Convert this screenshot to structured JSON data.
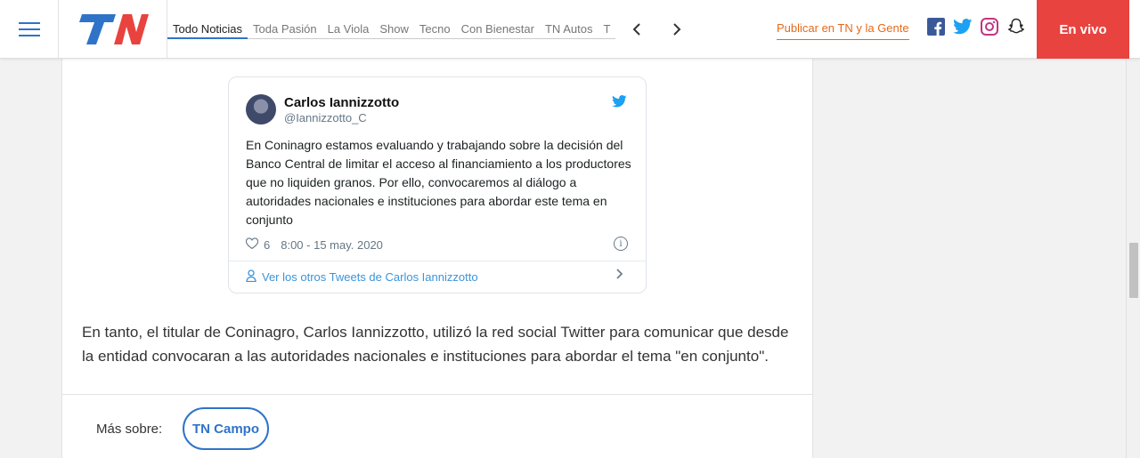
{
  "header": {
    "logo_text": "TN",
    "nav_items": [
      "Todo Noticias",
      "Toda Pasión",
      "La Viola",
      "Show",
      "Tecno",
      "Con Bienestar",
      "TN Autos",
      "T"
    ],
    "publish_link": "Publicar en TN y la Gente",
    "live_button": "En vivo",
    "social_icons": [
      "facebook-icon",
      "twitter-icon",
      "instagram-icon",
      "snapchat-icon"
    ]
  },
  "tweet": {
    "author_name": "Carlos Iannizzotto",
    "author_handle": "@Iannizzotto_C",
    "text": "En Coninagro estamos evaluando y trabajando sobre la decisión del Banco Central de limitar el acceso al financiamiento a los productores que no liquiden granos. Por ello, convocaremos al diálogo a autoridades nacionales e instituciones para abordar este tema en conjunto",
    "likes": "6",
    "timestamp": "8:00 - 15 may. 2020",
    "more_link": "Ver los otros Tweets de Carlos Iannizzotto"
  },
  "article": {
    "paragraph": "En tanto, el titular de Coninagro, Carlos Iannizzotto, utilizó la red social Twitter para comunicar que desde la entidad convocaran a las autoridades nacionales e instituciones para abordar el tema \"en conjunto\"."
  },
  "footer": {
    "more_about_label": "Más sobre:",
    "tag": "TN Campo"
  },
  "colors": {
    "accent": "#2f73c9",
    "live_bg": "#e8433f",
    "publish": "#e46a1a",
    "twitter_blue": "#1da1f2"
  }
}
